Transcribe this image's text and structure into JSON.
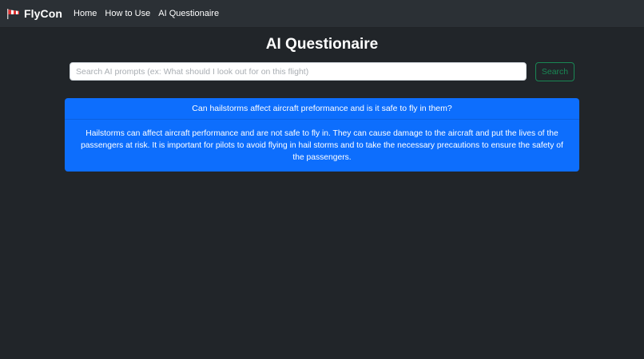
{
  "nav": {
    "brand": "FlyCon",
    "brand_icon": "windsock-icon",
    "links": [
      "Home",
      "How to Use",
      "AI Questionaire"
    ]
  },
  "page": {
    "title": "AI Questionaire"
  },
  "search": {
    "placeholder": "Search AI prompts (ex: What should I look out for on this flight)",
    "value": "",
    "button_label": "Search",
    "button_color": "#198754"
  },
  "answer": {
    "question": "Can hailstorms affect aircraft preformance and is it safe to fly in them?",
    "response": "Hailstorms can affect aircraft performance and are not safe to fly in. They can cause damage to the aircraft and put the lives of the passengers at risk. It is important for pilots to avoid flying in hail storms and to take the necessary precautions to ensure the safety of the passengers.",
    "card_color": "#0d6efd"
  },
  "colors": {
    "background": "#212529",
    "navbar": "#2b3035"
  }
}
